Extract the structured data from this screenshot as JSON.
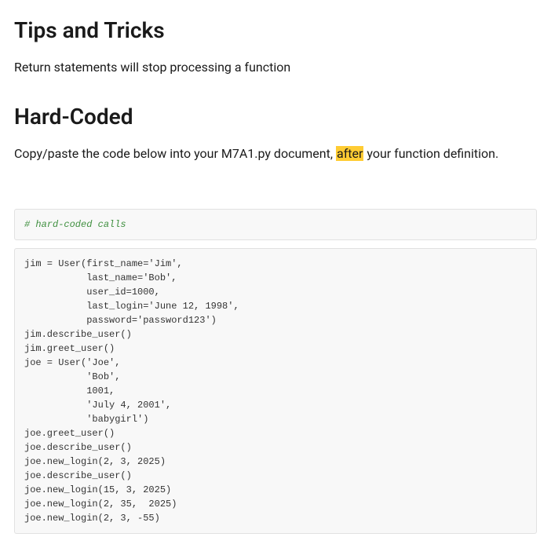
{
  "headings": {
    "tips": "Tips and Tricks",
    "hardcoded": "Hard-Coded"
  },
  "paragraphs": {
    "tips_body": "Return statements will stop processing a function",
    "hardcoded_prefix": "Copy/paste the code below into your M7A1.py document, ",
    "hardcoded_highlight": "after",
    "hardcoded_suffix": " your function definition."
  },
  "code": {
    "comment": "# hard-coded calls",
    "body": "jim = User(first_name='Jim',\n           last_name='Bob',\n           user_id=1000,\n           last_login='June 12, 1998',\n           password='password123')\njim.describe_user()\njim.greet_user()\njoe = User('Joe',\n           'Bob',\n           1001,\n           'July 4, 2001',\n           'babygirl')\njoe.greet_user()\njoe.describe_user()\njoe.new_login(2, 3, 2025)\njoe.describe_user()\njoe.new_login(15, 3, 2025)\njoe.new_login(2, 35,  2025)\njoe.new_login(2, 3, -55)"
  }
}
